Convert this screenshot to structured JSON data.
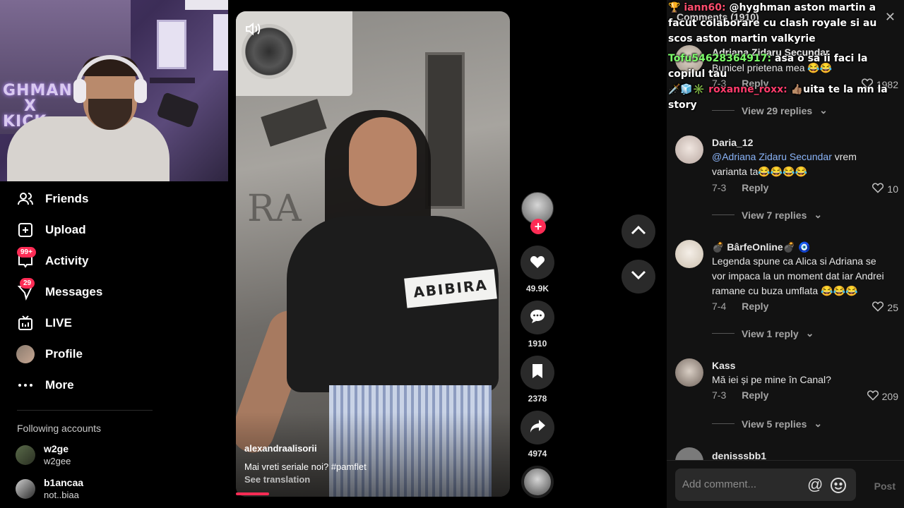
{
  "webcam": {
    "poster_line1": "GHMAN",
    "poster_line2": "X",
    "poster_line3": "KICK"
  },
  "sidebar": {
    "items": [
      {
        "label": "Friends",
        "icon": "friends-icon"
      },
      {
        "label": "Upload",
        "icon": "upload-icon"
      },
      {
        "label": "Activity",
        "icon": "activity-icon",
        "badge": "99+"
      },
      {
        "label": "Messages",
        "icon": "messages-icon",
        "badge": "29"
      },
      {
        "label": "LIVE",
        "icon": "live-icon"
      },
      {
        "label": "Profile",
        "icon": "profile-avatar"
      },
      {
        "label": "More",
        "icon": "more-icon"
      }
    ],
    "following_title": "Following accounts",
    "following": [
      {
        "name": "w2ge",
        "handle": "w2gee"
      },
      {
        "name": "b1ancaa",
        "handle": "not..biaa"
      }
    ]
  },
  "video": {
    "author": "alexandraalisorii",
    "caption": "Mai vreti seriale noi? #pamflet",
    "see_translation": "See translation",
    "sign_text": "ABIBIRA",
    "graffiti": "RA",
    "progress": 0.12
  },
  "actions": {
    "likes": "49.9K",
    "comments": "1910",
    "saves": "2378",
    "shares": "4974"
  },
  "comments_panel": {
    "title": "Comments (1910)",
    "comments": [
      {
        "name": "Adriana Zidaru Secundar",
        "text": "Bunicel prietena mea 😂😂",
        "date": "7-3",
        "reply": "Reply",
        "likes": "1982",
        "view_replies": "View 29 replies"
      },
      {
        "name": "Daria_12",
        "mention": "@Adriana Zidaru Secundar",
        "text": " vrem varianta ta😂😂😂😂",
        "date": "7-3",
        "reply": "Reply",
        "likes": "10",
        "view_replies": "View 7 replies"
      },
      {
        "name": "💣 BârfeOnline💣 🧿",
        "text": "Legenda spune ca Alica si Adriana se vor impaca la un moment dat iar Andrei ramane cu buza umflata 😂😂😂",
        "date": "7-4",
        "reply": "Reply",
        "likes": "25",
        "view_replies": "View 1 reply"
      },
      {
        "name": "Kass",
        "text": "Mă iei și pe mine în Canal?",
        "date": "7-3",
        "reply": "Reply",
        "likes": "209",
        "view_replies": "View 5 replies"
      },
      {
        "name": "denisssbb1"
      }
    ],
    "input_placeholder": "Add comment...",
    "post_label": "Post"
  },
  "chat": [
    {
      "user": "iann60:",
      "message": " @hyghman aston martin a facut colaborare cu clash royale si au scos aston martin valkyrie"
    },
    {
      "user": "Tofu54628364917:",
      "message": " asa o sa ii faci la copilul tau"
    },
    {
      "user": "roxanne_roxx:",
      "message": " 👍🏽uita te la mn la story"
    }
  ]
}
